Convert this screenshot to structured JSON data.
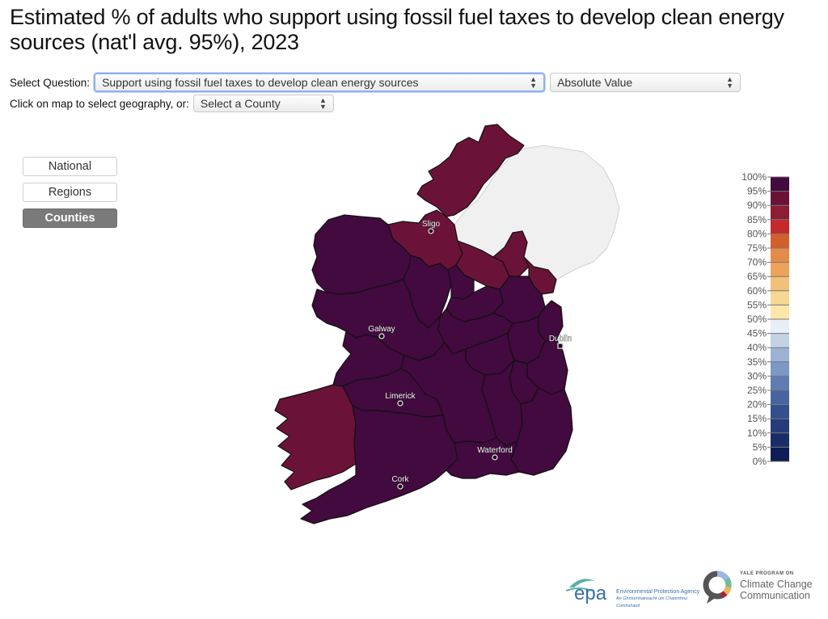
{
  "title": "Estimated % of adults who support using fossil fuel taxes to develop clean energy sources (nat'l avg. 95%), 2023",
  "controls": {
    "question_label": "Select Question:",
    "question_value": "Support using fossil fuel taxes to develop clean energy sources",
    "value_type": "Absolute Value",
    "geography_label": "Click on map to select geography, or:",
    "county_placeholder": "Select a County"
  },
  "geo_buttons": [
    {
      "label": "National",
      "active": false
    },
    {
      "label": "Regions",
      "active": false
    },
    {
      "label": "Counties",
      "active": true
    }
  ],
  "map": {
    "no_data_color": "#f0f0f0",
    "cities": [
      {
        "name": "Sligo",
        "marker": "circle"
      },
      {
        "name": "Galway",
        "marker": "circle"
      },
      {
        "name": "Dublin",
        "marker": "square"
      },
      {
        "name": "Limerick",
        "marker": "circle"
      },
      {
        "name": "Waterford",
        "marker": "circle"
      },
      {
        "name": "Cork",
        "marker": "circle"
      }
    ],
    "regions": [
      {
        "name": "Donegal",
        "bin": "90-95%",
        "color": "#6b1238"
      },
      {
        "name": "Sligo-Leitrim",
        "bin": "90-95%",
        "color": "#6b1238"
      },
      {
        "name": "Cavan",
        "bin": "90-95%",
        "color": "#6b1238"
      },
      {
        "name": "Monaghan",
        "bin": "90-95%",
        "color": "#6b1238"
      },
      {
        "name": "Louth",
        "bin": "90-95%",
        "color": "#6b1238"
      },
      {
        "name": "Kerry",
        "bin": "90-95%",
        "color": "#6b1238"
      },
      {
        "name": "Mayo",
        "bin": "95-100%",
        "color": "#420a3e"
      },
      {
        "name": "Roscommon",
        "bin": "95-100%",
        "color": "#420a3e"
      },
      {
        "name": "Longford",
        "bin": "95-100%",
        "color": "#420a3e"
      },
      {
        "name": "Westmeath",
        "bin": "95-100%",
        "color": "#420a3e"
      },
      {
        "name": "Meath",
        "bin": "95-100%",
        "color": "#420a3e"
      },
      {
        "name": "Galway",
        "bin": "95-100%",
        "color": "#420a3e"
      },
      {
        "name": "Offaly",
        "bin": "95-100%",
        "color": "#420a3e"
      },
      {
        "name": "Kildare",
        "bin": "95-100%",
        "color": "#420a3e"
      },
      {
        "name": "Dublin",
        "bin": "95-100%",
        "color": "#420a3e"
      },
      {
        "name": "Wicklow",
        "bin": "95-100%",
        "color": "#420a3e"
      },
      {
        "name": "Laois",
        "bin": "95-100%",
        "color": "#420a3e"
      },
      {
        "name": "Clare",
        "bin": "95-100%",
        "color": "#420a3e"
      },
      {
        "name": "Tipperary",
        "bin": "95-100%",
        "color": "#420a3e"
      },
      {
        "name": "Kilkenny",
        "bin": "95-100%",
        "color": "#420a3e"
      },
      {
        "name": "Carlow",
        "bin": "95-100%",
        "color": "#420a3e"
      },
      {
        "name": "Wexford",
        "bin": "95-100%",
        "color": "#420a3e"
      },
      {
        "name": "Limerick",
        "bin": "95-100%",
        "color": "#420a3e"
      },
      {
        "name": "Cork",
        "bin": "95-100%",
        "color": "#420a3e"
      },
      {
        "name": "Waterford",
        "bin": "95-100%",
        "color": "#420a3e"
      },
      {
        "name": "Northern Ireland",
        "bin": "no data",
        "color": "#f0f0f0"
      }
    ]
  },
  "legend": {
    "ticks": [
      "100%",
      "95%",
      "90%",
      "85%",
      "80%",
      "75%",
      "70%",
      "65%",
      "60%",
      "55%",
      "50%",
      "45%",
      "40%",
      "35%",
      "30%",
      "25%",
      "20%",
      "15%",
      "10%",
      "5%",
      "0%"
    ],
    "bins": [
      {
        "range": "95-100%",
        "color": "#420a3e"
      },
      {
        "range": "90-95%",
        "color": "#6b1238"
      },
      {
        "range": "85-90%",
        "color": "#8e1c32"
      },
      {
        "range": "80-85%",
        "color": "#c4292b"
      },
      {
        "range": "75-80%",
        "color": "#d2602c"
      },
      {
        "range": "70-75%",
        "color": "#e58b49"
      },
      {
        "range": "65-70%",
        "color": "#eda35a"
      },
      {
        "range": "60-65%",
        "color": "#f1c17b"
      },
      {
        "range": "55-60%",
        "color": "#f5d894"
      },
      {
        "range": "50-55%",
        "color": "#fbe8a8"
      },
      {
        "range": "45-50%",
        "color": "#e8eef7"
      },
      {
        "range": "40-45%",
        "color": "#c4d2e6"
      },
      {
        "range": "35-40%",
        "color": "#9bb2d2"
      },
      {
        "range": "30-35%",
        "color": "#7c98c4"
      },
      {
        "range": "25-30%",
        "color": "#5f7db3"
      },
      {
        "range": "20-25%",
        "color": "#4665a0"
      },
      {
        "range": "15-20%",
        "color": "#344f8d"
      },
      {
        "range": "10-15%",
        "color": "#253b7a"
      },
      {
        "range": "5-10%",
        "color": "#1a2c69"
      },
      {
        "range": "0-5%",
        "color": "#0f1c56"
      }
    ]
  },
  "logos": {
    "epa_mark": "epa",
    "epa_name": "Environmental Protection Agency",
    "epa_irish": "An Ghníomhaireacht um Chaomhnú Comhshaoil",
    "yale_small": "YALE PROGRAM ON",
    "yale_line1": "Climate Change",
    "yale_line2": "Communication"
  }
}
